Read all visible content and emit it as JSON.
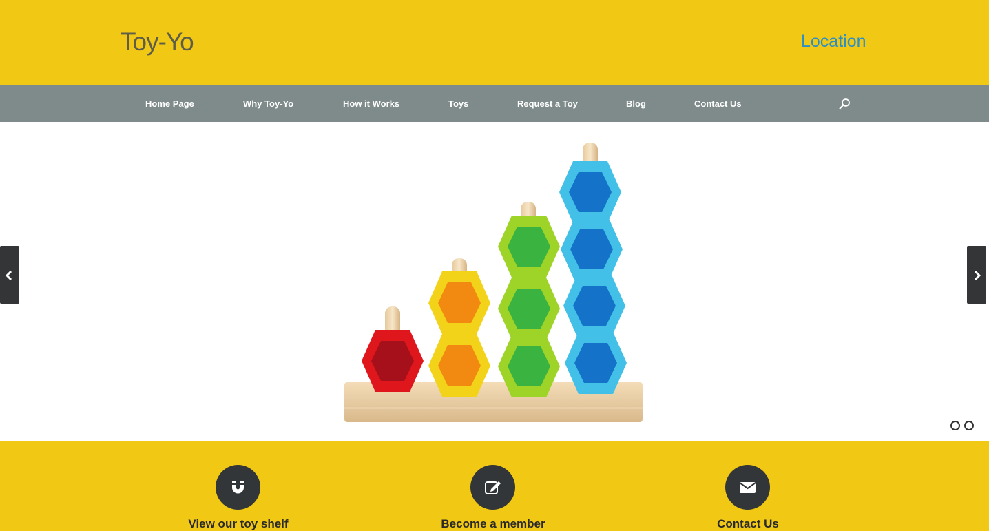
{
  "site": {
    "logo": "Toy-Yo",
    "location_link": "Location"
  },
  "nav": {
    "items": [
      {
        "label": "Home Page"
      },
      {
        "label": "Why Toy-Yo"
      },
      {
        "label": "How it Works"
      },
      {
        "label": "Toys"
      },
      {
        "label": "Request a Toy"
      },
      {
        "label": "Blog"
      },
      {
        "label": "Contact Us"
      }
    ],
    "search_icon": "search-icon"
  },
  "slider": {
    "image": "stacking-toy-hexagon-counting-image",
    "prev_icon": "chevron-left-icon",
    "next_icon": "chevron-right-icon",
    "slides_count": 2,
    "active_slide": 2
  },
  "features": [
    {
      "label": "View our toy shelf",
      "icon": "magnet-icon"
    },
    {
      "label": "Become a member",
      "icon": "edit-icon"
    },
    {
      "label": "Contact Us",
      "icon": "envelope-icon"
    }
  ],
  "colors": {
    "brand_yellow": "#f1c814",
    "nav_gray": "#7f8b8b",
    "link_blue": "#2b8fc7",
    "icon_dark": "#333638"
  }
}
